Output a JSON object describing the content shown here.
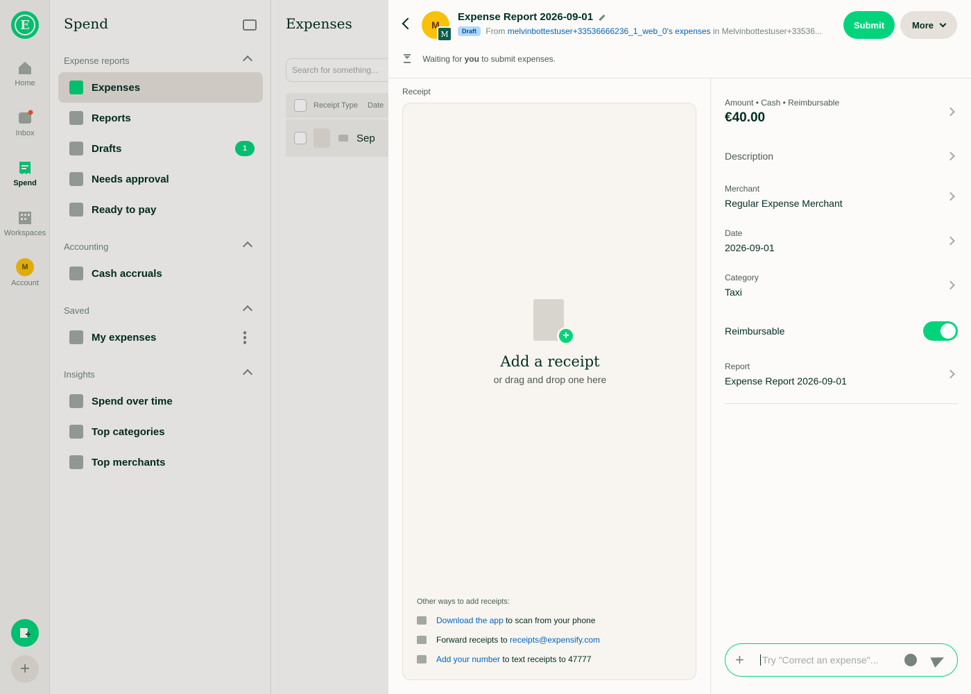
{
  "rail": {
    "logo": "E",
    "items": [
      {
        "label": "Home",
        "icon": "home-icon"
      },
      {
        "label": "Inbox",
        "icon": "inbox-icon"
      },
      {
        "label": "Spend",
        "icon": "receipt-icon"
      },
      {
        "label": "Workspaces",
        "icon": "building-icon"
      },
      {
        "label": "Account",
        "icon": "avatar",
        "avatar": "M"
      }
    ],
    "fab_plus": "+"
  },
  "sidebar": {
    "title": "Spend",
    "sections": [
      {
        "label": "Expense reports",
        "items": [
          {
            "label": "Expenses",
            "icon": "receipt-icon"
          },
          {
            "label": "Reports",
            "icon": "document-icon"
          },
          {
            "label": "Drafts",
            "icon": "pencil-icon",
            "badge": "1"
          },
          {
            "label": "Needs approval",
            "icon": "thumbs-up-icon"
          },
          {
            "label": "Ready to pay",
            "icon": "money-bag-icon"
          }
        ]
      },
      {
        "label": "Accounting",
        "items": [
          {
            "label": "Cash accruals",
            "icon": "cash-icon"
          }
        ]
      },
      {
        "label": "Saved",
        "items": [
          {
            "label": "My expenses",
            "icon": "receipt-user-icon"
          }
        ]
      },
      {
        "label": "Insights",
        "items": [
          {
            "label": "Spend over time",
            "icon": "calendar-icon"
          },
          {
            "label": "Top categories",
            "icon": "folder-icon"
          },
          {
            "label": "Top merchants",
            "icon": "basket-icon"
          }
        ]
      }
    ]
  },
  "middle": {
    "title": "Expenses",
    "search_placeholder": "Search for something...",
    "columns": [
      "Receipt Type",
      "Date"
    ],
    "row_date": "Sep"
  },
  "header": {
    "avatar": "M",
    "workspace_avatar": "M",
    "title": "Expense Report 2026-09-01",
    "draft_badge": "Draft",
    "from_prefix": "From",
    "from_link": "melvinbottestuser+33536666236_1_web_0's expenses",
    "in_text": "in",
    "in_workspace": "Melvinbottestuser+33536...",
    "submit_label": "Submit",
    "more_label": "More",
    "waiting_prefix": "Waiting for",
    "waiting_you": "you",
    "waiting_suffix": "to submit expenses."
  },
  "receipt": {
    "label": "Receipt",
    "add_title": "Add a receipt",
    "add_sub": "or drag and drop one here",
    "other_ways": "Other ways to add receipts:",
    "ways": [
      {
        "link": "Download the app",
        "text": "to scan from your phone",
        "icon": "download-icon"
      },
      {
        "prefix": "Forward receipts to",
        "link": "receipts@expensify.com",
        "icon": "mail-icon"
      },
      {
        "link": "Add your number",
        "text": "to text receipts to 47777",
        "icon": "chat-bubbles-icon"
      }
    ]
  },
  "details": {
    "amount_label": "Amount • Cash • Reimbursable",
    "amount_value": "€40.00",
    "description_label": "Description",
    "merchant_label": "Merchant",
    "merchant_value": "Regular Expense Merchant",
    "date_label": "Date",
    "date_value": "2026-09-01",
    "category_label": "Category",
    "category_value": "Taxi",
    "reimbursable_label": "Reimbursable",
    "reimbursable_on": true,
    "report_label": "Report",
    "report_value": "Expense Report 2026-09-01"
  },
  "composer": {
    "placeholder": "Try \"Correct an expense\"..."
  },
  "colors": {
    "accent": "#03d47c",
    "link": "#0164bf",
    "text": "#002e22",
    "badge_draft_bg": "#b0d9ff"
  }
}
